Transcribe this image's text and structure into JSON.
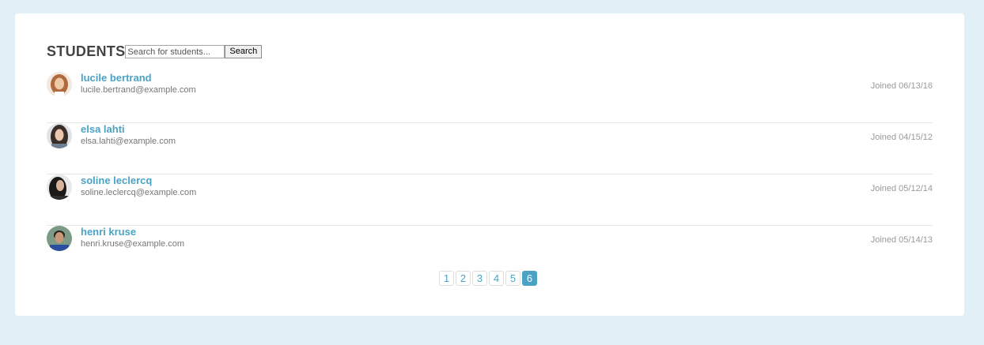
{
  "header": {
    "title": "STUDENTS",
    "search_placeholder": "Search for students...",
    "search_button": "Search"
  },
  "students": [
    {
      "name": "lucile bertrand",
      "email": "lucile.bertrand@example.com",
      "joined": "Joined 06/13/16"
    },
    {
      "name": "elsa lahti",
      "email": "elsa.lahti@example.com",
      "joined": "Joined 04/15/12"
    },
    {
      "name": "soline leclercq",
      "email": "soline.leclercq@example.com",
      "joined": "Joined 05/12/14"
    },
    {
      "name": "henri kruse",
      "email": "henri.kruse@example.com",
      "joined": "Joined 05/14/13"
    }
  ],
  "pagination": {
    "pages": [
      "1",
      "2",
      "3",
      "4",
      "5",
      "6"
    ],
    "current": "6"
  },
  "colors": {
    "accent": "#4aa3c5",
    "background": "#e1f0f6"
  }
}
